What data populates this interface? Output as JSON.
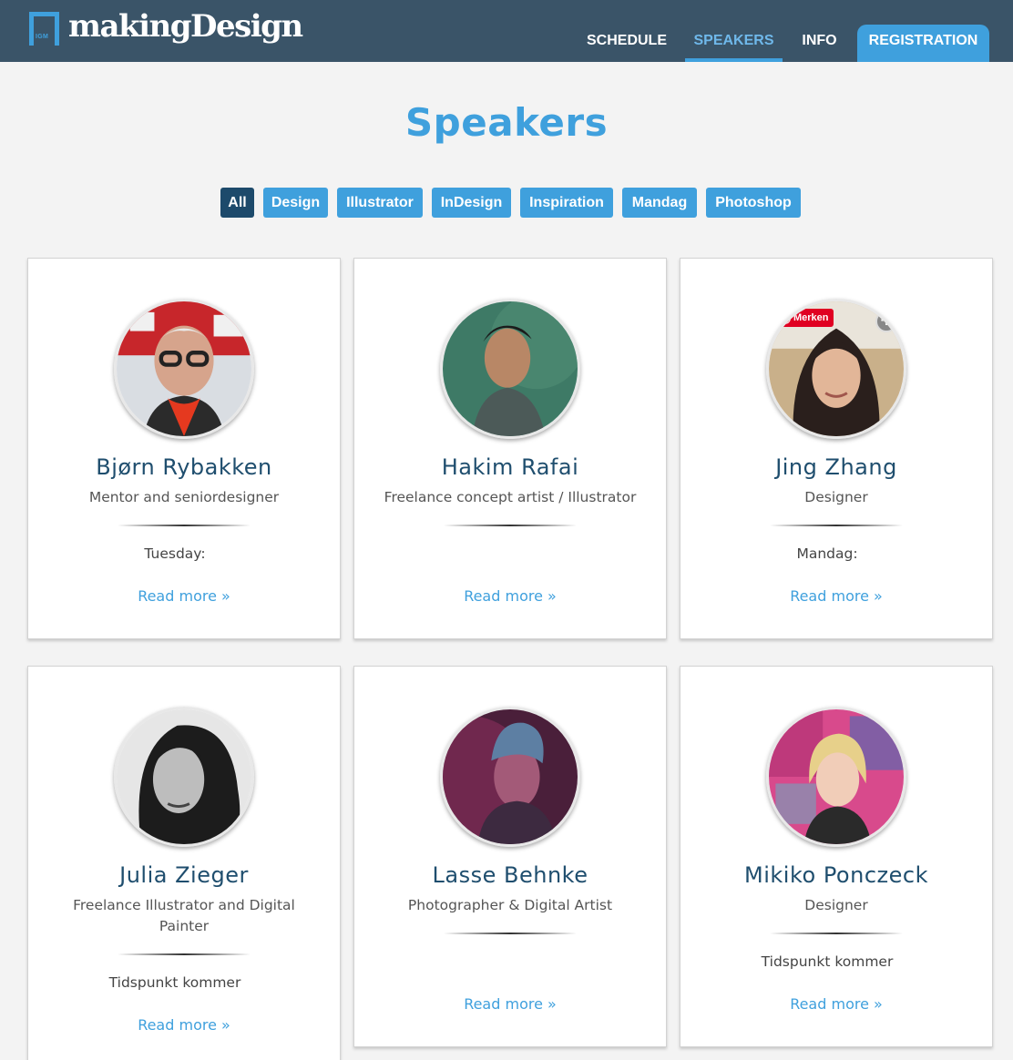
{
  "header": {
    "logo_badge": "IGM",
    "logo_text": "makingDesign",
    "nav": {
      "schedule": "SCHEDULE",
      "speakers": "SPEAKERS",
      "info": "INFO",
      "registration": "REGISTRATION"
    }
  },
  "page": {
    "title": "Speakers"
  },
  "filters": [
    "All",
    "Design",
    "Illustrator",
    "InDesign",
    "Inspiration",
    "Mandag",
    "Photoshop"
  ],
  "active_filter": "All",
  "speakers": [
    {
      "name": "Bjørn Rybakken",
      "role": "Mentor and seniordesigner",
      "when": "Tuesday:",
      "read_more": "Read more »"
    },
    {
      "name": "Hakim Rafai",
      "role": "Freelance concept artist / Illustrator",
      "when": "",
      "read_more": "Read more »"
    },
    {
      "name": "Jing Zhang",
      "role": "Designer",
      "when": "Mandag:",
      "read_more": "Read more »",
      "pin_label": "Merken"
    },
    {
      "name": "Julia Zieger",
      "role": "Freelance Illustrator and Digital Painter",
      "when": "Tidspunkt kommer",
      "read_more": "Read more »"
    },
    {
      "name": "Lasse Behnke",
      "role": "Photographer & Digital Artist",
      "when": "",
      "read_more": "Read more »"
    },
    {
      "name": "Mikiko Ponczeck",
      "role": "Designer",
      "when": "Tidspunkt kommer",
      "read_more": "Read more »"
    }
  ],
  "colors": {
    "header_bg": "#3a5468",
    "accent": "#3fa0dd",
    "active_filter": "#1d4a6b",
    "name": "#1f4e6e",
    "pinterest": "#e00022"
  }
}
